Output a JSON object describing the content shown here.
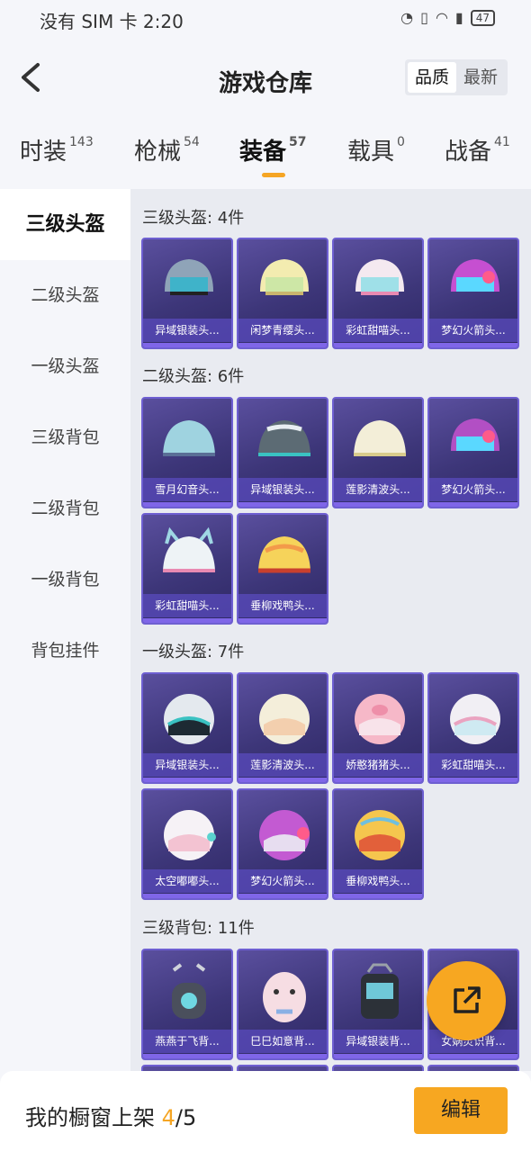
{
  "status_bar": {
    "text": "没有 SIM 卡 2:20",
    "battery": "47"
  },
  "header": {
    "title": "游戏仓库",
    "sort_options": [
      "品质",
      "最新"
    ],
    "active_sort": "品质"
  },
  "tabs": [
    {
      "label": "时装",
      "count": "143"
    },
    {
      "label": "枪械",
      "count": "54"
    },
    {
      "label": "装备",
      "count": "57"
    },
    {
      "label": "载具",
      "count": "0"
    },
    {
      "label": "战备",
      "count": "41"
    }
  ],
  "active_tab": "装备",
  "sidebar": [
    "三级头盔",
    "二级头盔",
    "一级头盔",
    "三级背包",
    "二级背包",
    "一级背包",
    "背包挂件"
  ],
  "active_sidebar": "三级头盔",
  "sections": [
    {
      "title": "三级头盔: 4件",
      "items": [
        "异域银装头...",
        "闲梦青缨头...",
        "彩虹甜喵头...",
        "梦幻火箭头..."
      ]
    },
    {
      "title": "二级头盔: 6件",
      "items": [
        "雪月幻音头...",
        "异域银装头...",
        "莲影清波头...",
        "梦幻火箭头...",
        "彩虹甜喵头...",
        "垂柳戏鸭头..."
      ]
    },
    {
      "title": "一级头盔: 7件",
      "items": [
        "异域银装头...",
        "莲影清波头...",
        "娇憨猪猪头...",
        "彩虹甜喵头...",
        "太空嘟嘟头...",
        "梦幻火箭头...",
        "垂柳戏鸭头..."
      ]
    },
    {
      "title": "三级背包: 11件",
      "items": [
        "燕燕于飞背...",
        "巳巳如意背...",
        "异域银装背...",
        "女娲灵识背..."
      ]
    }
  ],
  "bottom": {
    "label": "我的橱窗上架",
    "current": "4",
    "total": "/5",
    "edit_label": "编辑"
  },
  "colors": {
    "accent": "#f7a721",
    "card_bg": "#3d3679",
    "card_border": "#6e5fd1"
  }
}
